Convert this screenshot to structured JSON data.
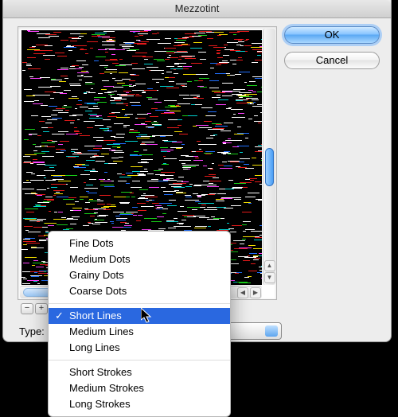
{
  "dialog": {
    "title": "Mezzotint"
  },
  "buttons": {
    "ok": "OK",
    "cancel": "Cancel"
  },
  "zoom": {
    "out": "−",
    "in": "+"
  },
  "type": {
    "label": "Type:",
    "selected": "Short Lines",
    "options": {
      "group1": [
        "Fine Dots",
        "Medium Dots",
        "Grainy Dots",
        "Coarse Dots"
      ],
      "group2": [
        "Short Lines",
        "Medium Lines",
        "Long Lines"
      ],
      "group3": [
        "Short Strokes",
        "Medium Strokes",
        "Long Strokes"
      ]
    }
  },
  "scroll_arrows": {
    "up": "▲",
    "down": "▼",
    "left": "◀",
    "right": "▶"
  }
}
